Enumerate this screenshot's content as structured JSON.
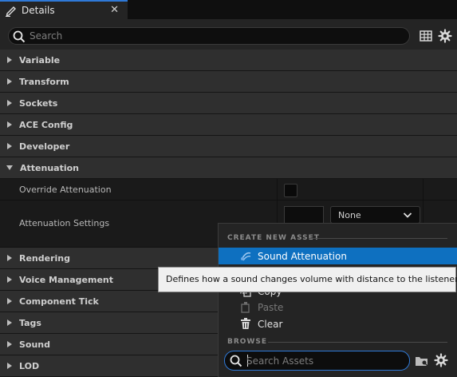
{
  "tab": {
    "title": "Details",
    "close": "✕"
  },
  "search": {
    "placeholder": "Search",
    "value": ""
  },
  "categories_top": [
    {
      "label": "Variable",
      "expanded": false
    },
    {
      "label": "Transform",
      "expanded": false
    },
    {
      "label": "Sockets",
      "expanded": false
    },
    {
      "label": "ACE Config",
      "expanded": false
    },
    {
      "label": "Developer",
      "expanded": false
    },
    {
      "label": "Attenuation",
      "expanded": true
    }
  ],
  "attenuation": {
    "override_label": "Override Attenuation",
    "override_checked": false,
    "settings_label": "Attenuation Settings",
    "settings_value": "None"
  },
  "categories_bottom": [
    {
      "label": "Rendering",
      "expanded": false
    },
    {
      "label": "Voice Management",
      "expanded": false
    },
    {
      "label": "Component Tick",
      "expanded": false
    },
    {
      "label": "Tags",
      "expanded": false
    },
    {
      "label": "Sound",
      "expanded": false
    },
    {
      "label": "LOD",
      "expanded": false
    }
  ],
  "menu": {
    "create_header": "CREATE NEW ASSET",
    "create_item": "Sound Attenuation",
    "copy": "Copy",
    "paste": "Paste",
    "clear": "Clear",
    "browse_header": "BROWSE",
    "search_placeholder": "Search Assets"
  },
  "tooltip": "Defines how a sound changes volume with distance to the listener",
  "colors": {
    "accent": "#0e70c0",
    "focus": "#2f79d7"
  }
}
